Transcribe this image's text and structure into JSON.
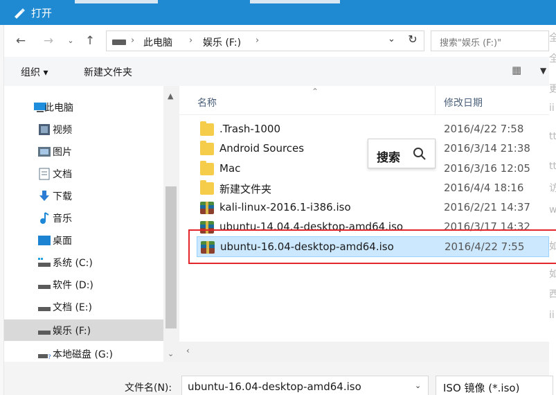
{
  "window": {
    "title": "打开"
  },
  "nav": {
    "breadcrumbs": [
      "此电脑",
      "娱乐 (F:)"
    ],
    "search_placeholder": "搜索\"娱乐 (F:)\""
  },
  "toolbar": {
    "organize": "组织 ▾",
    "new_folder": "新建文件夹"
  },
  "sidebar": {
    "items": [
      {
        "label": "此电脑",
        "icon": "computer-icon"
      },
      {
        "label": "视频",
        "icon": "video-icon"
      },
      {
        "label": "图片",
        "icon": "image-icon"
      },
      {
        "label": "文档",
        "icon": "document-icon"
      },
      {
        "label": "下载",
        "icon": "download-icon"
      },
      {
        "label": "音乐",
        "icon": "music-icon"
      },
      {
        "label": "桌面",
        "icon": "desktop-icon"
      },
      {
        "label": "系统 (C:)",
        "icon": "system-drive-icon"
      },
      {
        "label": "软件 (D:)",
        "icon": "drive-icon"
      },
      {
        "label": "文档 (E:)",
        "icon": "drive-icon"
      },
      {
        "label": "娱乐 (F:)",
        "icon": "drive-icon",
        "selected": true
      },
      {
        "label": "本地磁盘 (G:)",
        "icon": "local-disk-icon"
      }
    ]
  },
  "columns": {
    "name": "名称",
    "date": "修改日期"
  },
  "files": [
    {
      "name": ".Trash-1000",
      "date": "2016/4/22 7:58",
      "type": "folder"
    },
    {
      "name": "Android Sources",
      "date": "2016/3/14 21:38",
      "type": "folder"
    },
    {
      "name": "Mac",
      "date": "2016/3/16 12:05",
      "type": "folder"
    },
    {
      "name": "新建文件夹",
      "date": "2016/4/4 18:16",
      "type": "folder"
    },
    {
      "name": "kali-linux-2016.1-i386.iso",
      "date": "2016/2/21 14:37",
      "type": "iso"
    },
    {
      "name": "ubuntu-14.04.4-desktop-amd64.iso",
      "date": "2016/3/17 14:32",
      "type": "iso"
    },
    {
      "name": "ubuntu-16.04-desktop-amd64.iso",
      "date": "2016/4/22 7:55",
      "type": "iso",
      "selected": true
    }
  ],
  "search_popup": {
    "label": "搜索"
  },
  "bottom": {
    "filename_label": "文件名(N):",
    "filename_value": "ubuntu-16.04-desktop-amd64.iso",
    "filter_value": "ISO 镜像 (*.iso)"
  },
  "background_text": [
    "全",
    "全",
    "更",
    "ii",
    "tt",
    "tt",
    "访",
    "w",
    "如",
    "如",
    "西",
    "ii"
  ],
  "colors": {
    "titlebar": "#1f8ad1",
    "selection": "#cce8ff",
    "highlight_box": "#e3252a"
  }
}
